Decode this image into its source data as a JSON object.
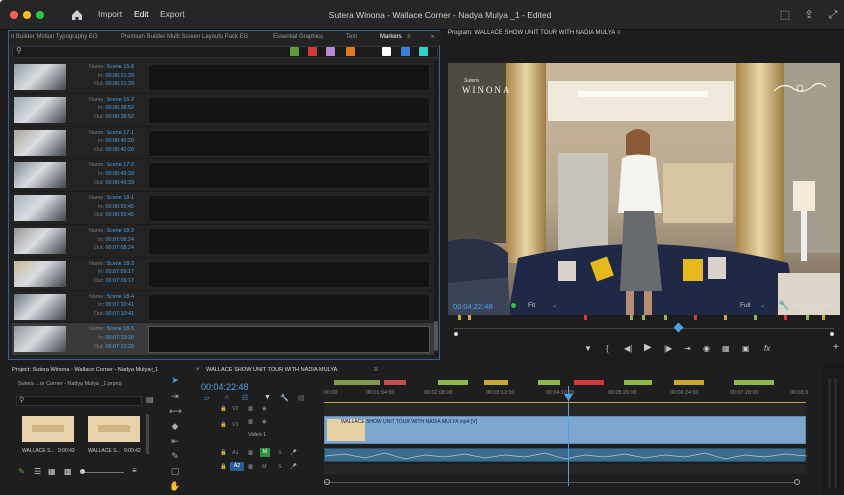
{
  "title_bar": {
    "menu": [
      "Import",
      "Edit",
      "Export"
    ],
    "active_menu": "Edit",
    "document_title": "Sutera Winona - Wallace Corner - Nadya Mulya _1 - Edited"
  },
  "left_panel": {
    "tabs": [
      "n Builder Motion Typography EG",
      "Premium Builder Multi Screen Layouts Pack EG",
      "Essential Graphics",
      "Text",
      "Markers"
    ],
    "active_tab": "Markers",
    "search_placeholder": "",
    "color_filters": [
      "#5e9c3c",
      "#d03a3a",
      "#b98ad6",
      "#e07b22",
      "#ffffff",
      "#3b7fe0",
      "#2fd6c8"
    ],
    "markers": [
      {
        "name": "Scene 15-8",
        "in": "00:06:21:33",
        "out": "00:06:21:33"
      },
      {
        "name": "Scene 16-2",
        "in": "00:06:38:52",
        "out": "00:06:38:52"
      },
      {
        "name": "Scene 17-1",
        "in": "00:06:40:20",
        "out": "00:06:40:20"
      },
      {
        "name": "Scene 17-2",
        "in": "00:06:49:33",
        "out": "00:06:49:33"
      },
      {
        "name": "Scene 18-1",
        "in": "00:06:55:45",
        "out": "00:06:55:45"
      },
      {
        "name": "Scene 18-2",
        "in": "00:07:08:24",
        "out": "00:07:08:24"
      },
      {
        "name": "Scene 18-3",
        "in": "00:07:09:17",
        "out": "00:07:09:17"
      },
      {
        "name": "Scene 18-4",
        "in": "00:07:10:41",
        "out": "00:07:10:41"
      },
      {
        "name": "Scene 18-5",
        "in": "00:07:13:20",
        "out": "00:07:13:20"
      }
    ],
    "labels": {
      "name": "Name:",
      "in": "In:",
      "out": "Out:"
    }
  },
  "program_monitor": {
    "title": "Program: WALLACE SHOW UNIT TOUR WITH NADIA MULYA",
    "video_logo_left": "WINONA",
    "video_logo_left_sub": "Sutera",
    "timecode_current": "00:04:22:48",
    "fit_label": "Fit",
    "resolution_label": "Full",
    "timecode_duration": "00:09:00:42"
  },
  "project_panel": {
    "tab": "Project: Sutera Winona - Wallace Corner - Nadya Mulya _1",
    "file": "Sutera ...or Corner - Nadya Mulya _1.prproj",
    "items": [
      {
        "name": "WALLACE S...",
        "dur": "9:00:42"
      },
      {
        "name": "WALLACE S...",
        "dur": "9:00:42"
      }
    ]
  },
  "timeline": {
    "tab": "WALLACE SHOW UNIT TOUR WITH NADIA MULYA",
    "timecode": "00:04:22:48",
    "ruler": [
      "00:00",
      "00:01:04:00",
      "00:02:08:00",
      "00:03:12:00",
      "00:04:16:00",
      "00:05:20:00",
      "00:06:24:00",
      "00:07:28:00",
      "00:08:3"
    ],
    "video_clip_label": "WALLACE SHOW UNIT TOUR WITH NADIA MULYA.mp4 [V]",
    "tracks": {
      "v2": "V2",
      "v1": "V1",
      "video1": "Video 1",
      "a1": "A1",
      "a2": "A2",
      "m": "M",
      "s": "S"
    }
  },
  "colors": {
    "accent": "#4aa3e8",
    "panel_border": "#2f5f9f",
    "timecode": "#4aa3e8",
    "video_clip": "#7fa6cc",
    "audio_clip": "#3c6b8c"
  }
}
